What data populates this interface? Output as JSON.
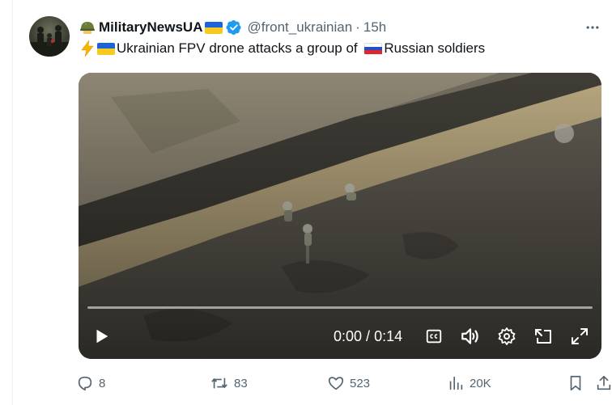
{
  "author": {
    "display_name": "MilitaryNewsUA",
    "handle": "@front_ukrainian",
    "separator": "·",
    "time": "15h",
    "verified": true
  },
  "tweet": {
    "text_part1": "Ukrainian FPV drone attacks a group of ",
    "text_part2": "Russian soldiers"
  },
  "video": {
    "current_time": "0:00",
    "time_separator": " / ",
    "duration": "0:14",
    "progress": 0,
    "icons": [
      "play-icon",
      "captions-icon",
      "volume-icon",
      "settings-icon",
      "picture-in-picture-icon",
      "fullscreen-icon"
    ]
  },
  "actions": {
    "replies": "8",
    "reposts": "83",
    "likes": "523",
    "views": "20K"
  },
  "colors": {
    "text": "#0f1419",
    "secondary": "#536471",
    "verified": "#1d9bf0",
    "flag_ua_blue": "#1a63d8",
    "flag_ua_yellow": "#f7c921"
  }
}
